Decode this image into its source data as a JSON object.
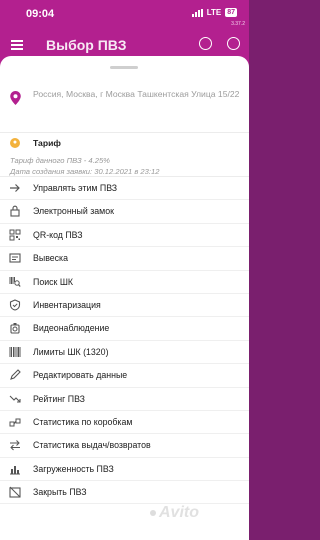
{
  "status_bar": {
    "time": "09:04",
    "network": "LTE",
    "battery": "87",
    "version": "3.37.2"
  },
  "header": {
    "title": "Выбор ПВЗ"
  },
  "address": {
    "text": "Россия, Москва, г Москва Ташкентская Улица 15/22"
  },
  "tariff": {
    "title": "Тариф",
    "rate_line": "Тариф данного ПВЗ - 4.25%",
    "date_line": "Дата создания заявки: 30.12.2021 в 23:12"
  },
  "menu": [
    {
      "label": "Управлять этим ПВЗ",
      "icon": "forward-arrow-icon"
    },
    {
      "label": "Электронный замок",
      "icon": "lock-icon"
    },
    {
      "label": "QR-код ПВЗ",
      "icon": "qr-code-icon"
    },
    {
      "label": "Вывеска",
      "icon": "signboard-icon"
    },
    {
      "label": "Поиск ШК",
      "icon": "barcode-search-icon"
    },
    {
      "label": "Инвентаризация",
      "icon": "shield-check-icon"
    },
    {
      "label": "Видеонаблюдение",
      "icon": "camera-icon"
    },
    {
      "label": "Лимиты ШК (1320)",
      "icon": "barcode-icon"
    },
    {
      "label": "Редактировать данные",
      "icon": "pencil-icon"
    },
    {
      "label": "Рейтинг ПВЗ",
      "icon": "trend-down-icon"
    },
    {
      "label": "Статистика по коробкам",
      "icon": "boxes-chart-icon"
    },
    {
      "label": "Статистика выдач/возвратов",
      "icon": "swap-icon"
    },
    {
      "label": "Загруженность ПВЗ",
      "icon": "load-chart-icon"
    },
    {
      "label": "Закрыть ПВЗ",
      "icon": "close-store-icon"
    }
  ],
  "watermark": {
    "text": "Avito"
  },
  "colors": {
    "brand": "#b3208f",
    "accent_yellow": "#f3b23d"
  }
}
